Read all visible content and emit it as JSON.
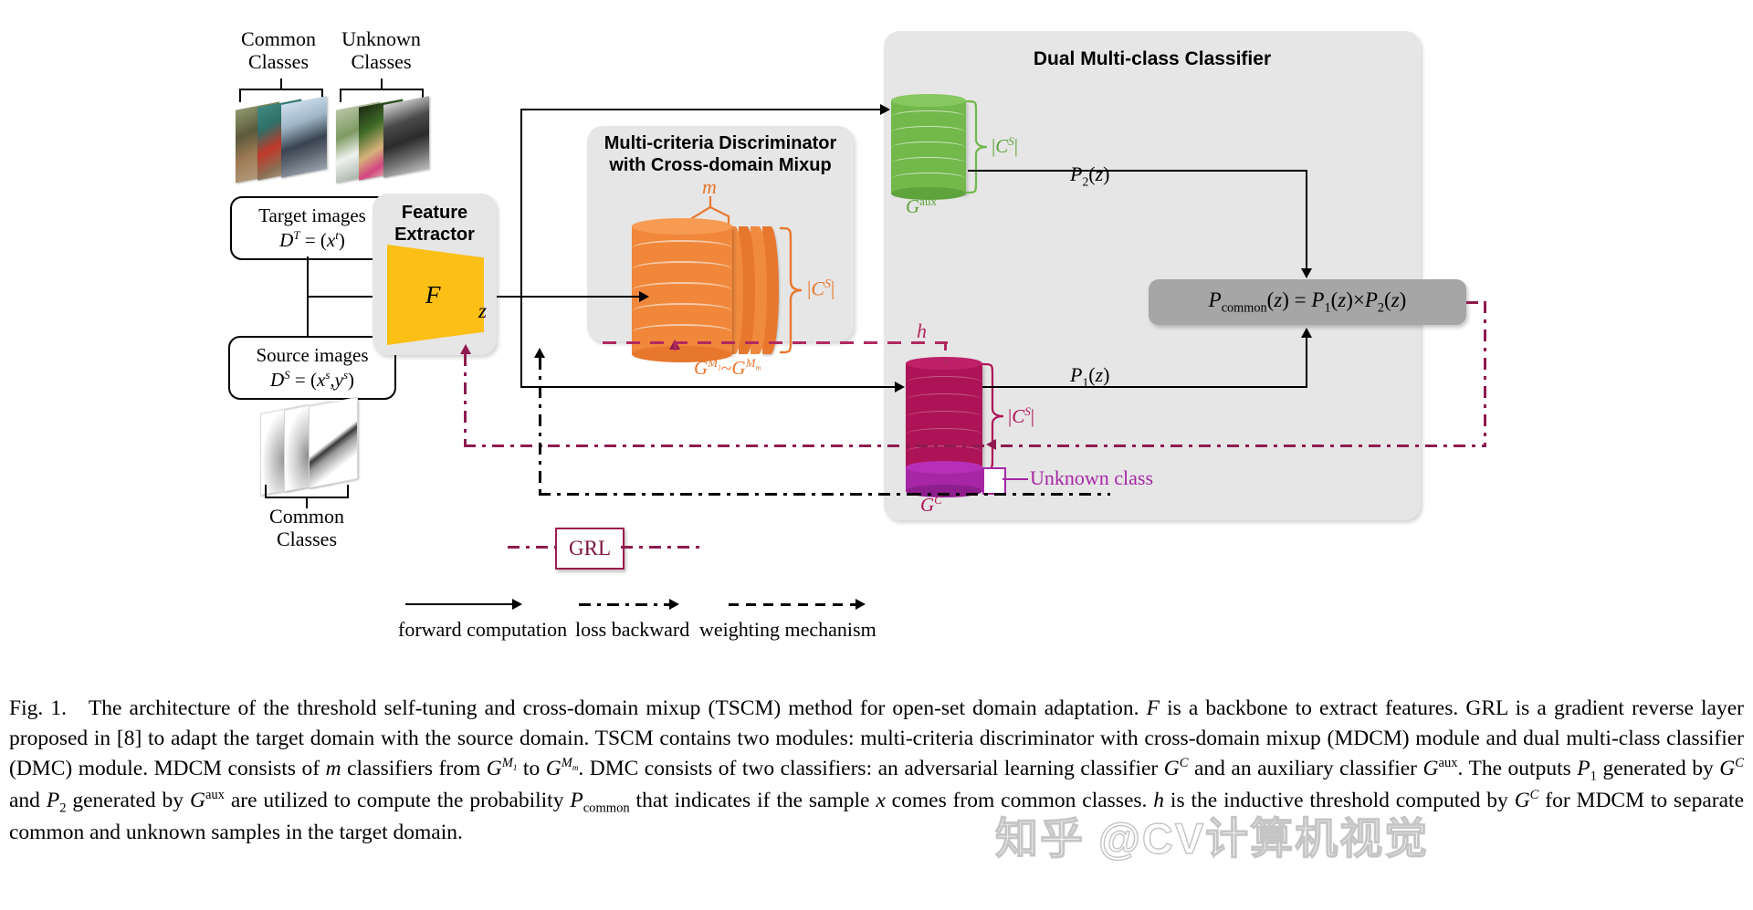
{
  "figure": {
    "labels": {
      "common_classes_top": "Common\nClasses",
      "unknown_classes_top": "Unknown\nClasses",
      "common_classes_bottom": "Common\nClasses"
    },
    "target_box": {
      "line1": "Target images",
      "line2": "D T = (x t)"
    },
    "source_box": {
      "line1": "Source images",
      "line2": "D S = (x s, y s)"
    },
    "feature_extractor": {
      "title": "Feature\nExtractor",
      "symbol": "F",
      "output": "z",
      "color": "#FBBF15"
    },
    "mdcm": {
      "title": "Multi-criteria Discriminator\nwith Cross-domain Mixup",
      "m_label": "m",
      "bracket_label": "|C S|",
      "bottom_label": "G M1 ~ G Mm",
      "color": "#F0873A"
    },
    "dmc": {
      "title": "Dual Multi-class Classifier",
      "aux": {
        "name": "G aux",
        "bracket_label": "|C S|",
        "color": "#72B84B"
      },
      "adv": {
        "name": "G C",
        "bracket_label": "|C S|",
        "unknown_label": "Unknown class",
        "color": "#AD1457",
        "unknown_color": "#A626A6"
      },
      "p2_label": "P2(z)",
      "p1_label": "P1(z)",
      "pcommon": "Pcommon(z) = P1(z)×P2(z)",
      "pcommon_color": "#a6a6a6"
    },
    "threshold_label": "h",
    "grl": {
      "label": "GRL",
      "color": "#8E1B50"
    },
    "legend": [
      {
        "style": "solid",
        "label": "forward computation"
      },
      {
        "style": "dash-dot",
        "label": "loss backward"
      },
      {
        "style": "dashed",
        "label": "weighting mechanism"
      }
    ]
  },
  "caption": {
    "fig_number": "Fig. 1.",
    "text": "The architecture of the threshold self-tuning and cross-domain mixup (TSCM) method for open-set domain adaptation. F is a backbone to extract features. GRL is a gradient reverse layer proposed in [8] to adapt the target domain with the source domain. TSCM contains two modules: multi-criteria discriminator with cross-domain mixup (MDCM) module and dual multi-class classifier (DMC) module. MDCM consists of m classifiers from G M1 to G Mm. DMC consists of two classifiers: an adversarial learning classifier G C and an auxiliary classifier G aux. The outputs P1 generated by G C and P2 generated by G aux are utilized to compute the probability Pcommon that indicates if the sample x comes from common classes. h is the inductive threshold computed by G C for MDCM to separate common and unknown samples in the target domain."
  },
  "watermark": {
    "text": "知乎 @CV计算机视觉"
  }
}
